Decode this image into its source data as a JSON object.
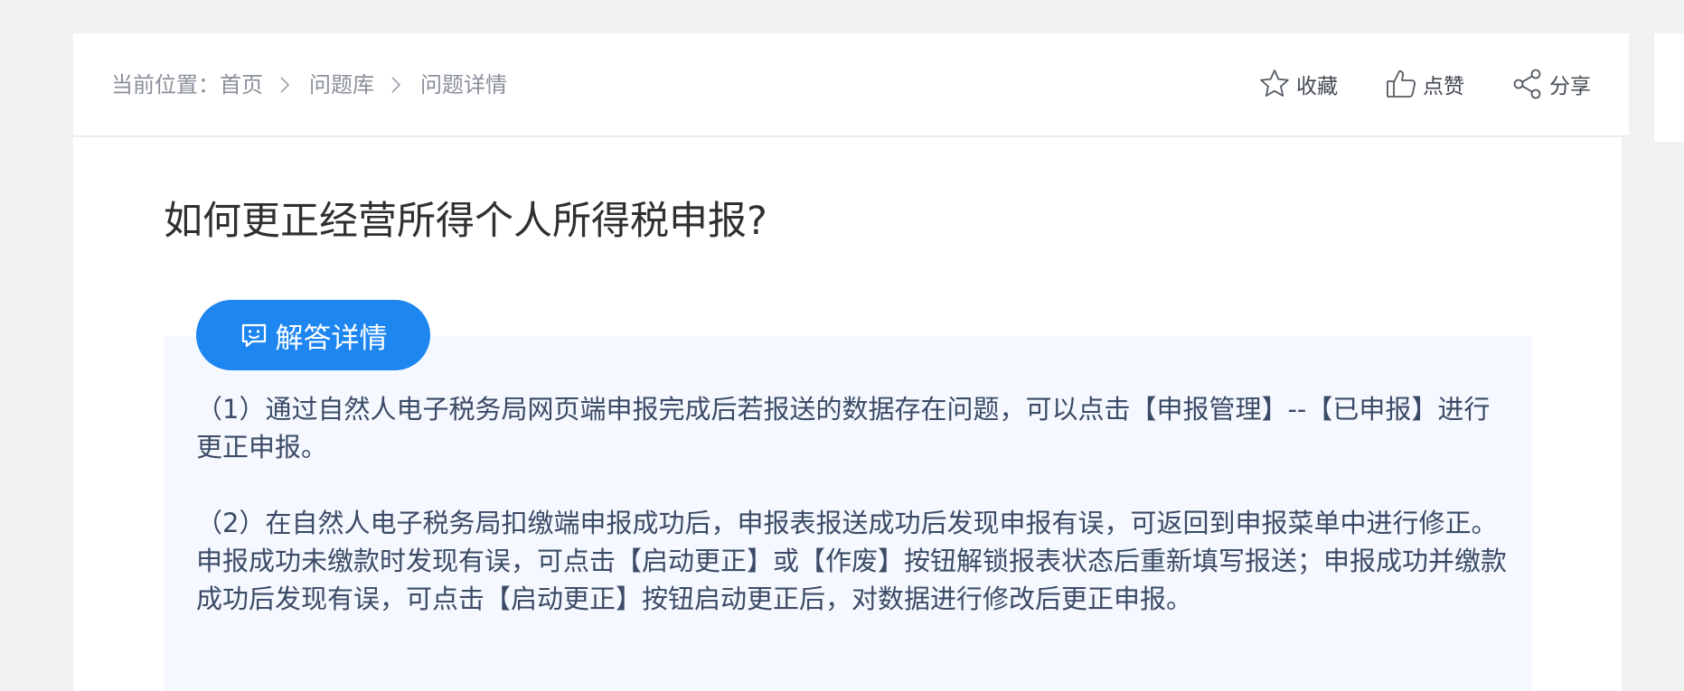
{
  "breadcrumb": {
    "prefix": "当前位置：",
    "items": [
      "首页",
      "问题库",
      "问题详情"
    ]
  },
  "actions": {
    "favorite": "收藏",
    "like": "点赞",
    "share": "分享"
  },
  "question": {
    "title": "如何更正经营所得个人所得税申报?"
  },
  "answer": {
    "tab_label": "解答详情",
    "paragraphs": [
      "（1）通过自然人电子税务局网页端申报完成后若报送的数据存在问题，可以点击【申报管理】--【已申报】进行更正申报。",
      "（2）在自然人电子税务局扣缴端申报成功后，申报表报送成功后发现申报有误，可返回到申报菜单中进行修正。申报成功未缴款时发现有误，可点击【启动更正】或【作废】按钮解锁报表状态后重新填写报送；申报成功并缴款成功后发现有误，可点击【启动更正】按钮启动更正后，对数据进行修改后更正申报。"
    ]
  },
  "icons": {
    "favorite": "star-outline-icon",
    "like": "thumbs-up-outline-icon",
    "share": "share-nodes-icon",
    "answer_tab": "chat-smile-icon",
    "separator": "chevron-right-icon"
  },
  "colors": {
    "background": "#f0f1f3",
    "accent": "#1e86f0",
    "answer_background": "#f5f9ff",
    "answer_text": "#3b4a66",
    "breadcrumb_text": "#8a8f99"
  }
}
